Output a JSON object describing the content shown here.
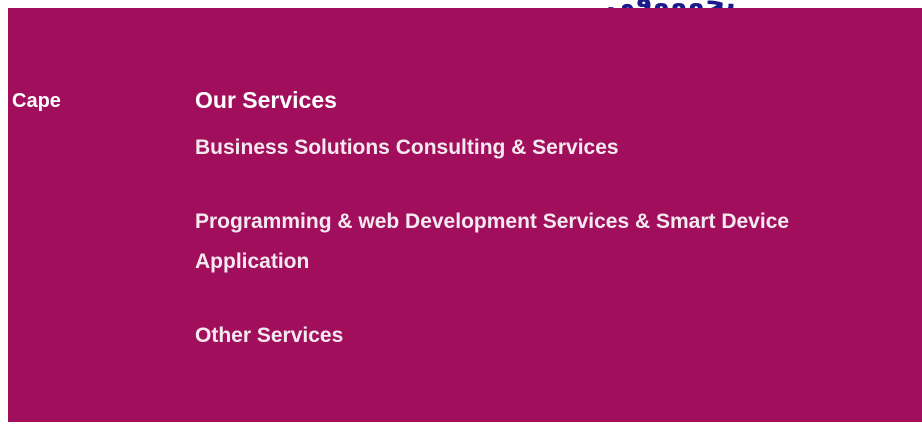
{
  "top_strip": {
    "cutoff_text": "يجوووقي"
  },
  "left": {
    "label": "Cape"
  },
  "services": {
    "heading": "Our Services",
    "items": [
      {
        "label": "Business Solutions Consulting & Services"
      },
      {
        "label": "Programming & web Development Services & Smart Device Application"
      },
      {
        "label": "Other Services"
      }
    ]
  },
  "colors": {
    "panel_background": "#a10e5c",
    "text": "#ffffff",
    "cutoff_text": "#1a1a8a"
  }
}
